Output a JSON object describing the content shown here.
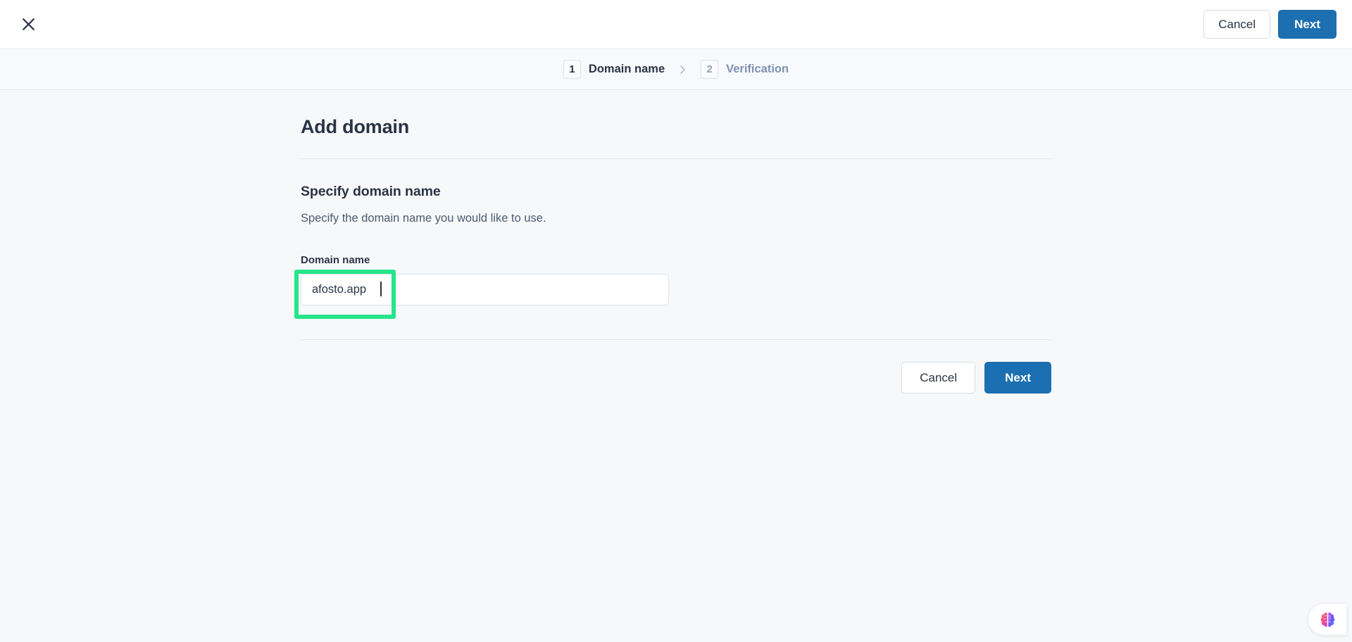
{
  "window": {
    "close_icon": "close-icon"
  },
  "topbar": {
    "cancel_label": "Cancel",
    "next_label": "Next"
  },
  "stepper": {
    "separator": "›",
    "steps": [
      {
        "number": "1",
        "label": "Domain name",
        "state": "active"
      },
      {
        "number": "2",
        "label": "Verification",
        "state": "inactive"
      }
    ]
  },
  "main": {
    "title": "Add domain",
    "section": {
      "heading": "Specify domain name",
      "description": "Specify the domain name you would like to use.",
      "field": {
        "label": "Domain name",
        "value": "afosto.app",
        "placeholder": ""
      }
    },
    "actions": {
      "cancel_label": "Cancel",
      "next_label": "Next"
    }
  },
  "assistant": {
    "icon": "brain-icon"
  },
  "colors": {
    "primary": "#1C6FB0",
    "highlight": "#26E58A",
    "page_background": "#F7F8FA",
    "text": "#2B3445",
    "muted_text": "#7E93B2",
    "border": "#E4E8EC"
  }
}
